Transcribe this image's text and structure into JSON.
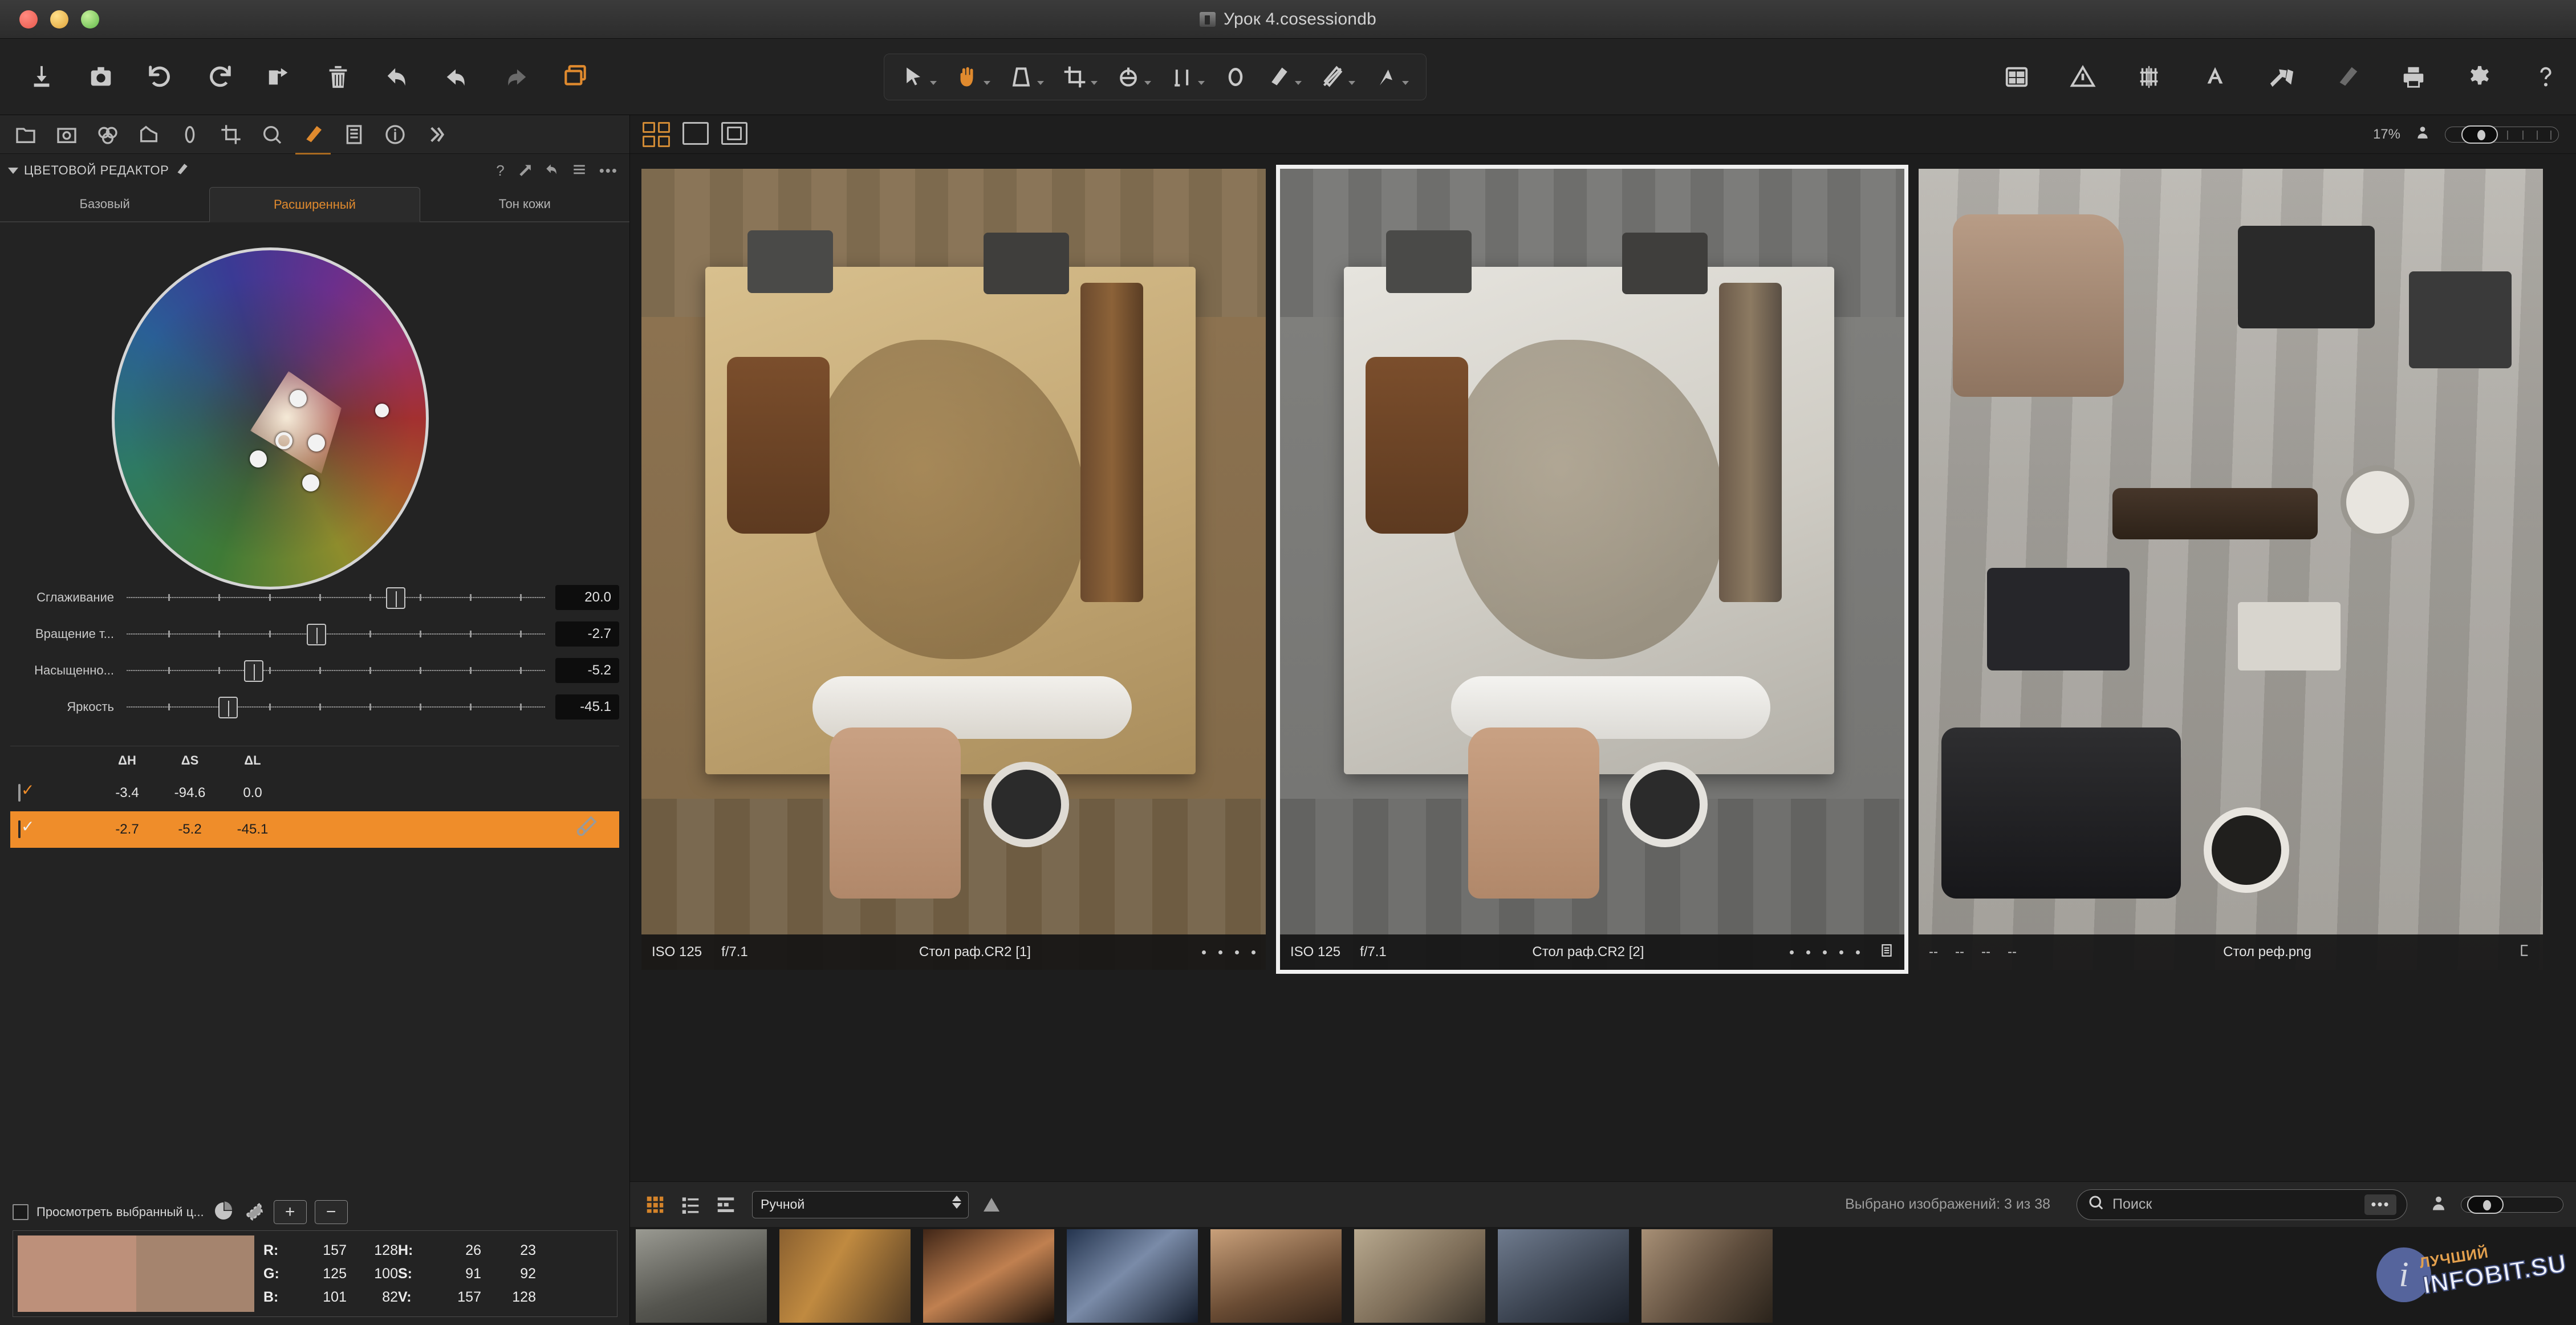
{
  "window": {
    "title": "Урок 4.cosessiondb",
    "traffic_lights": [
      "close",
      "minimize",
      "zoom"
    ]
  },
  "toolbar": {
    "left_icons": [
      {
        "name": "import-icon",
        "label": "Импорт"
      },
      {
        "name": "capture-icon",
        "label": "Захват"
      },
      {
        "name": "rotate-left-icon",
        "label": "Повернуть влево"
      },
      {
        "name": "rotate-right-icon",
        "label": "Повернуть вправо"
      },
      {
        "name": "export-icon",
        "label": "Экспорт"
      },
      {
        "name": "trash-icon",
        "label": "Удалить"
      },
      {
        "name": "reset-icon",
        "label": "Сброс"
      },
      {
        "name": "undo-icon",
        "label": "Отменить"
      },
      {
        "name": "redo-icon",
        "label": "Вернуть"
      },
      {
        "name": "variants-icon",
        "label": "Варианты"
      }
    ],
    "center_tools": [
      {
        "name": "pointer-tool",
        "active": false
      },
      {
        "name": "hand-tool",
        "active": true
      },
      {
        "name": "keystone-tool",
        "active": false
      },
      {
        "name": "crop-tool",
        "active": false
      },
      {
        "name": "rotate-tool",
        "active": false
      },
      {
        "name": "straighten-tool",
        "active": false
      },
      {
        "name": "spot-removal-tool",
        "active": false
      },
      {
        "name": "draw-mask-tool",
        "active": false
      },
      {
        "name": "erase-mask-tool",
        "active": false
      },
      {
        "name": "gradient-mask-tool",
        "active": false
      }
    ],
    "right_icons": [
      {
        "name": "metadata-icon"
      },
      {
        "name": "alert-icon"
      },
      {
        "name": "grid-overlay-icon"
      },
      {
        "name": "annotation-icon"
      },
      {
        "name": "arrows-icon"
      },
      {
        "name": "brush-icon"
      },
      {
        "name": "print-icon"
      },
      {
        "name": "settings-gear-icon"
      },
      {
        "name": "help-icon"
      }
    ]
  },
  "left_panel": {
    "tool_tabs": [
      {
        "name": "library-icon",
        "active": false
      },
      {
        "name": "capture-icon",
        "active": false
      },
      {
        "name": "lens-icon",
        "active": false
      },
      {
        "name": "exposure-icon",
        "active": false
      },
      {
        "name": "color-icon",
        "active": false
      },
      {
        "name": "crop-icon",
        "active": false
      },
      {
        "name": "details-icon",
        "active": false
      },
      {
        "name": "color-editor-icon",
        "active": true
      },
      {
        "name": "adjustments-icon",
        "active": false
      },
      {
        "name": "metadata-icon",
        "active": false
      },
      {
        "name": "more-icon",
        "active": false
      }
    ],
    "panel_title": "ЦВЕТОВОЙ РЕДАКТОР",
    "panel_actions": [
      "help-icon",
      "apply-icon",
      "reset-icon",
      "menu-icon",
      "more-icon"
    ],
    "tabs": [
      {
        "label": "Базовый",
        "active": false
      },
      {
        "label": "Расширенный",
        "active": true
      },
      {
        "label": "Тон кожи",
        "active": false
      }
    ],
    "sliders": [
      {
        "label": "Сглаживание",
        "value": "20.0",
        "pos": 50
      },
      {
        "label": "Вращение т...",
        "value": "-2.7",
        "pos": 34
      },
      {
        "label": "Насыщенно...",
        "value": "-5.2",
        "pos": 23
      },
      {
        "label": "Яркость",
        "value": "-45.1",
        "pos": 19
      }
    ],
    "delta_table": {
      "headers": [
        "ΔH",
        "ΔS",
        "ΔL"
      ],
      "rows": [
        {
          "checked": true,
          "dH": "-3.4",
          "dS": "-94.6",
          "dL": "0.0",
          "selected": false
        },
        {
          "checked": true,
          "dH": "-2.7",
          "dS": "-5.2",
          "dL": "-45.1",
          "selected": true
        }
      ]
    },
    "preview_row": {
      "checkbox_label": "Просмотреть выбранный ц...",
      "icons": [
        "pie-view-icon",
        "mask-view-icon"
      ],
      "add_label": "+",
      "remove_label": "−"
    },
    "readout": {
      "swatch_a": "#bd907a",
      "swatch_b": "#a5846e",
      "rows": [
        {
          "label": "R:",
          "v1": "157",
          "v2": "128",
          "label2": "H:",
          "v3": "26",
          "v4": "23"
        },
        {
          "label": "G:",
          "v1": "125",
          "v2": "100",
          "label2": "S:",
          "v3": "91",
          "v4": "92"
        },
        {
          "label": "B:",
          "v1": "101",
          "v2": "82",
          "label2": "V:",
          "v3": "157",
          "v4": "128"
        }
      ]
    }
  },
  "viewer": {
    "view_modes": [
      {
        "name": "multi-view-mode",
        "active": true
      },
      {
        "name": "single-view-mode",
        "active": false
      },
      {
        "name": "proof-view-mode",
        "active": false
      }
    ],
    "zoom_level": "17%",
    "images": [
      {
        "iso": "ISO 125",
        "aperture": "f/7.1",
        "filename": "Стол раф.CR2 [1]",
        "dots": 4,
        "selected": false,
        "has_badge": false,
        "style": "sepia"
      },
      {
        "iso": "ISO 125",
        "aperture": "f/7.1",
        "filename": "Стол раф.CR2 [2]",
        "dots": 5,
        "selected": true,
        "has_badge": true,
        "style": "neutral"
      },
      {
        "iso": "--",
        "aperture": "--",
        "filename": "Стол реф.png",
        "dashes": [
          "--",
          "--",
          "--",
          "--"
        ],
        "selected": false,
        "has_badge": true,
        "style": "grey"
      }
    ]
  },
  "bottom_bar": {
    "view_icons": [
      {
        "name": "grid-view-icon",
        "active": true
      },
      {
        "name": "list-view-icon",
        "active": false
      },
      {
        "name": "detail-view-icon",
        "active": false
      }
    ],
    "sort_mode": "Ручной",
    "selection_status": "Выбрано изображений: 3 из 38",
    "search_placeholder": "Поиск",
    "search_more": "•••"
  },
  "watermark": {
    "top_text": "ЛУЧШИЙ",
    "main_text": "INFOBIT.SU",
    "badge_letter": "i"
  },
  "colors": {
    "accent": "#e08a2e",
    "selection": "#ef8d2a",
    "panel_bg": "#232323",
    "viewer_bg": "#1d1d1d"
  }
}
